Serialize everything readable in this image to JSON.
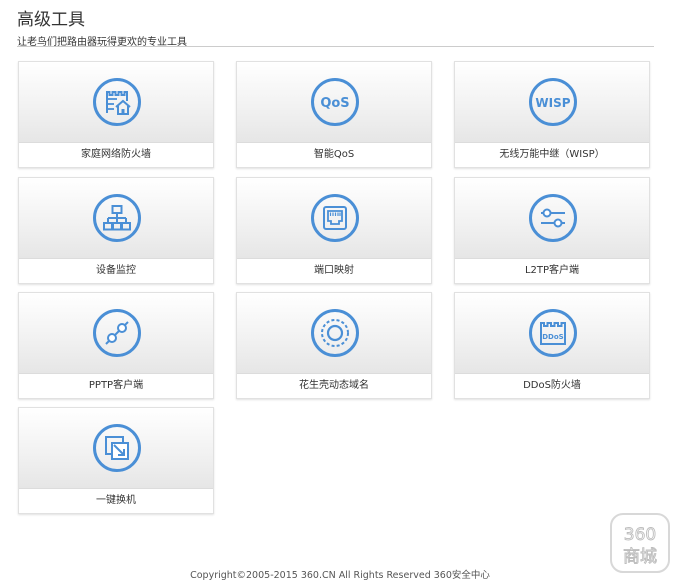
{
  "page": {
    "title": "高级工具",
    "subtitle": "让老鸟们把路由器玩得更欢的专业工具"
  },
  "colors": {
    "accent": "#4a8fd6",
    "divider": "#cccccc"
  },
  "tiles": [
    {
      "label": "家庭网络防火墙",
      "icon": "firewall-house-icon"
    },
    {
      "label": "智能QoS",
      "icon": "qos-icon",
      "icon_text": "QoS"
    },
    {
      "label": "无线万能中继（WISP）",
      "icon": "wisp-icon",
      "icon_text": "WISP"
    },
    {
      "label": "设备监控",
      "icon": "device-topology-icon"
    },
    {
      "label": "端口映射",
      "icon": "ethernet-port-icon"
    },
    {
      "label": "L2TP客户端",
      "icon": "sliders-icon"
    },
    {
      "label": "PPTP客户端",
      "icon": "link-icon"
    },
    {
      "label": "花生壳动态域名",
      "icon": "dynamic-dns-icon"
    },
    {
      "label": "DDoS防火墙",
      "icon": "ddos-icon",
      "icon_text": "DDoS"
    },
    {
      "label": "一键换机",
      "icon": "switch-device-icon"
    }
  ],
  "footer": {
    "copyright": "Copyright©2005-2015 360.CN All Rights Reserved 360安全中心"
  },
  "watermark": {
    "line1": "360",
    "line2": "商城"
  }
}
